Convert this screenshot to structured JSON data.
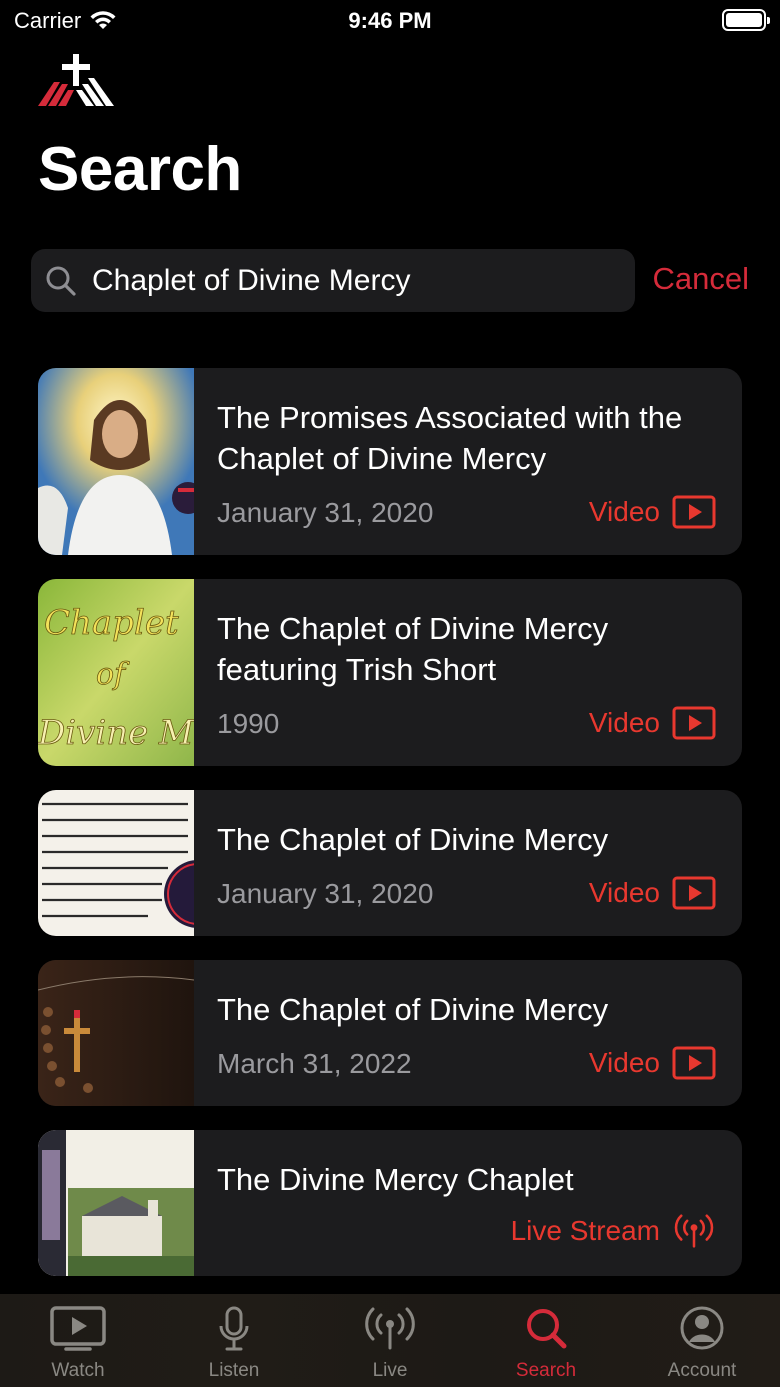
{
  "status_bar": {
    "carrier": "Carrier",
    "time": "9:46 PM"
  },
  "page": {
    "title": "Search"
  },
  "search": {
    "value": "Chaplet of Divine Mercy",
    "cancel_label": "Cancel"
  },
  "results": [
    {
      "title": "The Promises Associated with the Chaplet of Divine Mercy",
      "meta": "January 31, 2020",
      "type": "Video",
      "type_icon": "play-box-icon",
      "thumbnail": "divine-mercy-portrait"
    },
    {
      "title": "The Chaplet of Divine Mercy featuring Trish Short",
      "meta": "1990",
      "type": "Video",
      "type_icon": "play-box-icon",
      "thumbnail": "chaplet-of-divine-mercy-title-card"
    },
    {
      "title": "The Chaplet of Divine Mercy",
      "meta": "January 31, 2020",
      "type": "Video",
      "type_icon": "play-box-icon",
      "thumbnail": "diary-page-text"
    },
    {
      "title": "The Chaplet of Divine Mercy",
      "meta": "March 31, 2022",
      "type": "Video",
      "type_icon": "play-box-icon",
      "thumbnail": "episode-29-rosary"
    },
    {
      "title": "The Divine Mercy Chaplet",
      "meta": "",
      "type": "Live Stream",
      "type_icon": "broadcast-icon",
      "thumbnail": "national-shrine"
    }
  ],
  "tabs": [
    {
      "label": "Watch",
      "icon": "tv-play-icon",
      "active": false
    },
    {
      "label": "Listen",
      "icon": "microphone-icon",
      "active": false
    },
    {
      "label": "Live",
      "icon": "broadcast-icon",
      "active": false
    },
    {
      "label": "Search",
      "icon": "search-icon",
      "active": true
    },
    {
      "label": "Account",
      "icon": "person-circle-icon",
      "active": false
    }
  ],
  "colors": {
    "accent": "#d52b3a",
    "card_background": "#1c1c1e",
    "background": "#000000"
  }
}
